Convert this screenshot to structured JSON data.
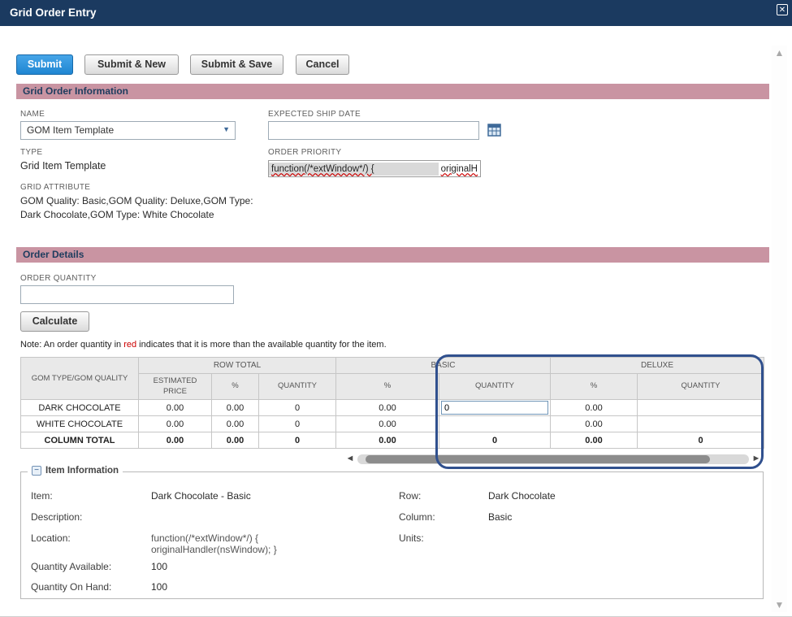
{
  "window": {
    "title": "Grid Order Entry"
  },
  "icons": {
    "close": "✕",
    "dropdown_arrow": "▼",
    "scroll_up": "▲",
    "scroll_down": "▼",
    "scroll_left": "◄",
    "scroll_right": "►",
    "collapse_minus": "−"
  },
  "colors": {
    "titlebar": "#1b3a60",
    "section_bar": "#c994a2",
    "primary_button": "#1f86d2",
    "highlight_box": "#30508e",
    "note_red": "#cc0000"
  },
  "buttons": {
    "submit": "Submit",
    "submit_new": "Submit & New",
    "submit_save": "Submit & Save",
    "cancel": "Cancel",
    "calculate": "Calculate"
  },
  "section_headers": {
    "grid_order_information": "Grid Order Information",
    "order_details": "Order Details"
  },
  "fields": {
    "name": {
      "label": "NAME",
      "value": "GOM Item Template"
    },
    "expected_ship_date": {
      "label": "EXPECTED SHIP DATE",
      "value": ""
    },
    "type": {
      "label": "TYPE",
      "value": "Grid Item Template"
    },
    "order_priority": {
      "label": "ORDER PRIORITY",
      "text": "function(/*extWindow*/) {",
      "overflow_text": "originalH"
    },
    "grid_attribute": {
      "label": "GRID ATTRIBUTE",
      "value": "GOM Quality: Basic,GOM Quality: Deluxe,GOM Type: Dark Chocolate,GOM Type: White Chocolate"
    },
    "order_quantity": {
      "label": "ORDER QUANTITY",
      "value": ""
    }
  },
  "note": {
    "before": "Note: An order quantity in ",
    "highlight": "red",
    "after": " indicates that it is more than the available quantity for the item."
  },
  "grid": {
    "corner_header": "GOM TYPE/GOM QUALITY",
    "groups": [
      {
        "label": "ROW TOTAL",
        "columns": [
          "ESTIMATED PRICE",
          "%",
          "QUANTITY"
        ]
      },
      {
        "label": "BASIC",
        "columns": [
          "%",
          "QUANTITY"
        ]
      },
      {
        "label": "DELUXE",
        "columns": [
          "%",
          "QUANTITY"
        ]
      }
    ],
    "rows": [
      {
        "label": "DARK CHOCOLATE",
        "estimated_price": "0.00",
        "row_total_pct": "0.00",
        "row_total_qty": "0",
        "basic_pct": "0.00",
        "basic_qty_input": "0",
        "deluxe_pct": "0.00",
        "deluxe_qty": ""
      },
      {
        "label": "WHITE CHOCOLATE",
        "estimated_price": "0.00",
        "row_total_pct": "0.00",
        "row_total_qty": "0",
        "basic_pct": "0.00",
        "basic_qty": "",
        "deluxe_pct": "0.00",
        "deluxe_qty": ""
      },
      {
        "label": "COLUMN TOTAL",
        "estimated_price": "0.00",
        "row_total_pct": "0.00",
        "row_total_qty": "0",
        "basic_pct": "0.00",
        "basic_qty": "0",
        "deluxe_pct": "0.00",
        "deluxe_qty": "0"
      }
    ]
  },
  "item_information": {
    "legend": "Item Information",
    "fields": {
      "item": {
        "label": "Item:",
        "value": "Dark Chocolate - Basic"
      },
      "row": {
        "label": "Row:",
        "value": "Dark Chocolate"
      },
      "description": {
        "label": "Description:",
        "value": ""
      },
      "column": {
        "label": "Column:",
        "value": "Basic"
      },
      "location": {
        "label": "Location:",
        "value_line1": "function(/*extWindow*/) {",
        "value_line2": "originalHandler(nsWindow); }"
      },
      "units": {
        "label": "Units:",
        "value": ""
      },
      "quantity_available": {
        "label": "Quantity Available:",
        "value": "100"
      },
      "quantity_on_hand": {
        "label": "Quantity On Hand:",
        "value": "100"
      }
    }
  }
}
